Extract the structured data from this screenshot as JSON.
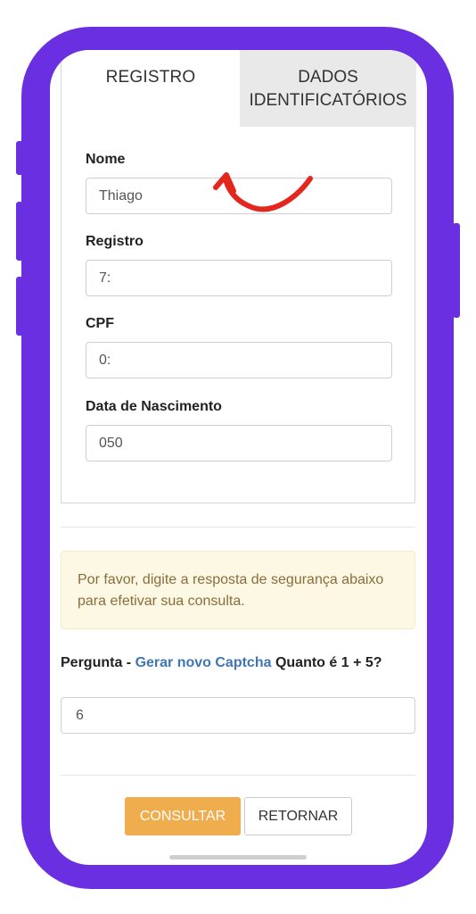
{
  "tabs": {
    "registro": "REGISTRO",
    "dados_line1": "DADOS",
    "dados_line2": "IDENTIFICATÓRIOS"
  },
  "form": {
    "nome": {
      "label": "Nome",
      "value": "Thiago"
    },
    "registro": {
      "label": "Registro",
      "value": "7:"
    },
    "cpf": {
      "label": "CPF",
      "value": "0:"
    },
    "nascimento": {
      "label": "Data de Nascimento",
      "value": "050"
    }
  },
  "alert": {
    "text": "Por favor, digite a resposta de segurança abaixo para efetivar sua consulta."
  },
  "captcha": {
    "prefix": "Pergunta - ",
    "link": "Gerar novo Captcha",
    "question": " Quanto é 1 + 5?",
    "answer": "6"
  },
  "buttons": {
    "consultar": "CONSULTAR",
    "retornar": "RETORNAR"
  },
  "colors": {
    "phone_frame": "#6a2fe0",
    "annotation_arrow": "#e3271f",
    "primary_button": "#f0ad4e",
    "alert_bg": "#fcf8e3",
    "link": "#3e76b5"
  }
}
